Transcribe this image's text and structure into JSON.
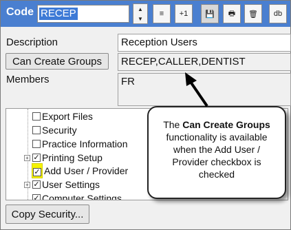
{
  "header": {
    "code_label": "Code",
    "code_value": "RECEP",
    "spin_up": "▲",
    "spin_down": "▼",
    "buttons": {
      "list_icon": "≡",
      "plus_one": "+1",
      "save_icon": "💾",
      "print_icon": "🖶",
      "delete_icon": "🗑",
      "db": "db"
    },
    "accent_color": "#4a7fd0"
  },
  "form": {
    "description_label": "Description",
    "description_value": "Reception Users",
    "can_create_groups_button": "Can Create Groups",
    "can_create_groups_value": "RECEP,CALLER,DENTIST",
    "members_label": "Members",
    "members_value": "FR"
  },
  "tree": {
    "items": [
      {
        "label": "Export Files",
        "checked": false,
        "expandable": false
      },
      {
        "label": "Security",
        "checked": false,
        "expandable": false
      },
      {
        "label": "Practice Information",
        "checked": false,
        "expandable": false
      },
      {
        "label": "Printing Setup",
        "checked": true,
        "expandable": true
      },
      {
        "label": "Add User / Provider",
        "checked": true,
        "expandable": false,
        "highlighted": true
      },
      {
        "label": "User Settings",
        "checked": true,
        "expandable": true
      },
      {
        "label": "Computer Settings",
        "checked": true,
        "expandable": false
      }
    ]
  },
  "callout": {
    "text_before": "The ",
    "bold": "Can Create Groups",
    "text_after": " functionality is available when the Add User / Provider checkbox is checked"
  },
  "footer": {
    "copy_security_button": "Copy Security..."
  }
}
